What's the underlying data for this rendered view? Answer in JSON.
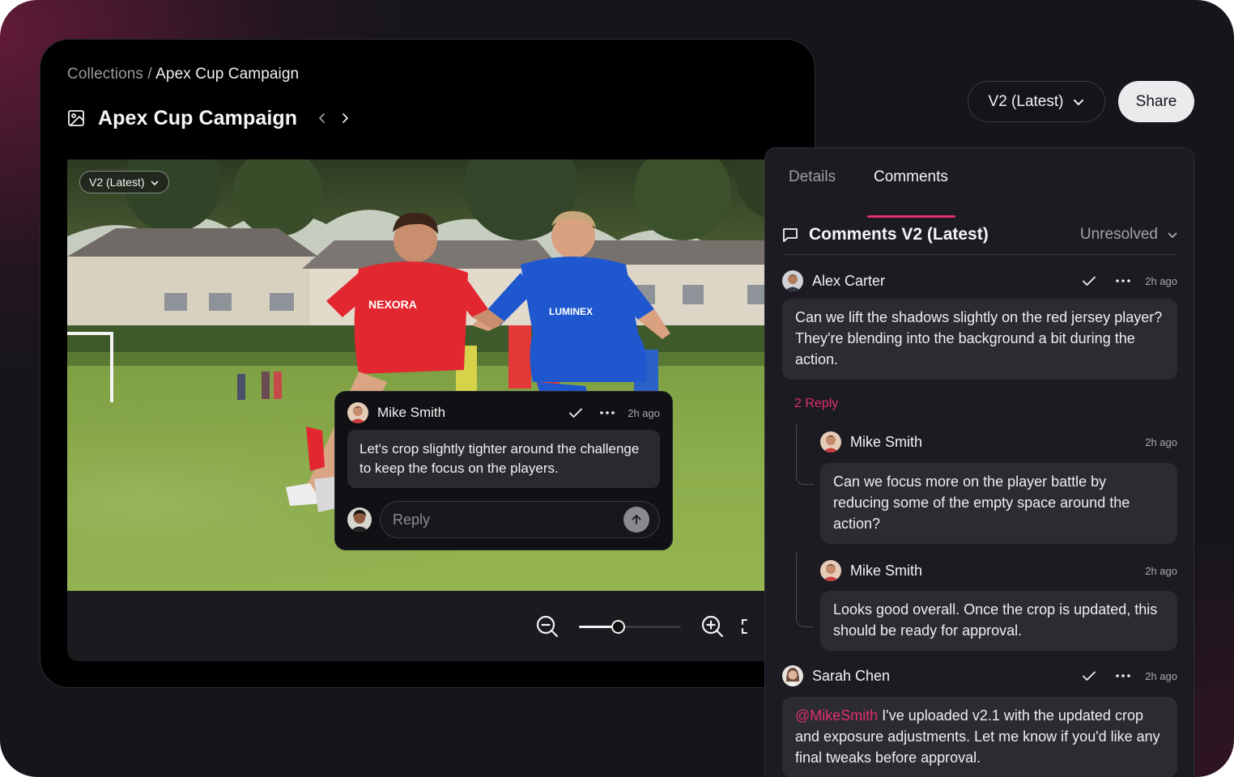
{
  "breadcrumb": {
    "parent": "Collections",
    "separator": "/",
    "current": "Apex Cup Campaign"
  },
  "asset": {
    "title": "Apex Cup Campaign",
    "icon": "image-icon"
  },
  "image": {
    "version_pill": "V2 (Latest)",
    "jersey_red_text": "NEXORA",
    "jersey_blue_text": "LUMINEX"
  },
  "popover": {
    "author": "Mike Smith",
    "time": "2h ago",
    "text": "Let's crop slightly tighter around the challenge to keep the focus on the players.",
    "reply_placeholder": "Reply"
  },
  "zoom": {
    "level": 0.38
  },
  "header_controls": {
    "version_select": "V2 (Latest)",
    "share_label": "Share"
  },
  "panel": {
    "tabs": [
      {
        "label": "Details"
      },
      {
        "label": "Comments",
        "active": true
      }
    ],
    "heading": "Comments V2 (Latest)",
    "filter": "Unresolved",
    "comments": [
      {
        "author": "Alex Carter",
        "time": "2h ago",
        "text": "Can we lift the shadows slightly on the red jersey player? They're blending into the background a bit during the action.",
        "reply_count": "2 Reply",
        "replies": [
          {
            "author": "Mike Smith",
            "time": "2h ago",
            "text": "Can we focus more on the player battle by reducing some of the empty space around the action?"
          },
          {
            "author": "Mike Smith",
            "time": "2h ago",
            "text": "Looks good overall. Once the crop is updated, this should be ready for approval."
          }
        ]
      },
      {
        "author": "Sarah Chen",
        "time": "2h ago",
        "mention": "@MikeSmith",
        "text": " I've uploaded v2.1 with the updated crop and exposure adjustments. Let me know if you'd like any final tweaks before approval."
      }
    ]
  },
  "colors": {
    "accent": "#e1306c",
    "background": "#17151c",
    "panel": "#1c1b21"
  }
}
